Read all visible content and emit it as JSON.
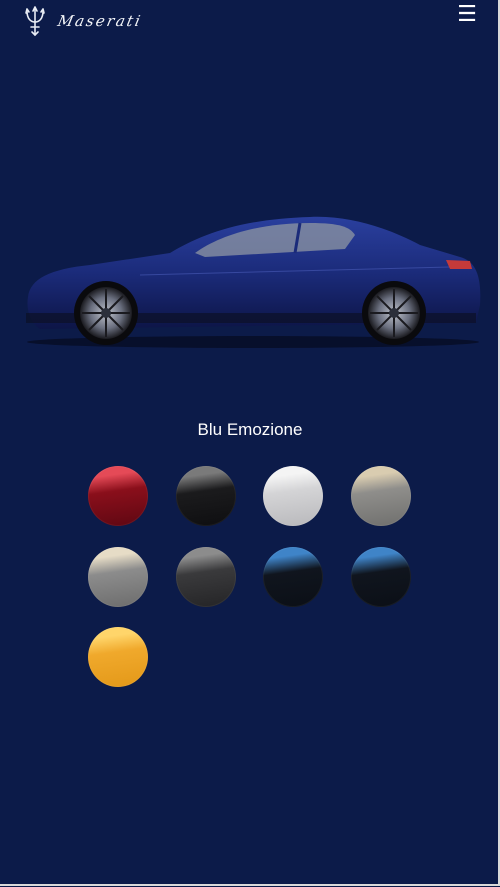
{
  "header": {
    "brand": "Maserati",
    "menu_icon": "hamburger-menu-icon",
    "logo_icon": "trident-icon"
  },
  "selected_color": "Blu Emozione",
  "colors": {
    "background": "#0c1b49",
    "car_body": "#1b2b7a"
  },
  "swatches": [
    {
      "top": "#e54a57",
      "mid": "#8a0f1b",
      "bottom": "#5e0712"
    },
    {
      "top": "#7a7a7a",
      "mid": "#1b1b1d",
      "bottom": "#0e0e10"
    },
    {
      "top": "#f4f4f4",
      "mid": "#d4d4d6",
      "bottom": "#b8b8bb"
    },
    {
      "top": "#d9ccb0",
      "mid": "#8f8e8b",
      "bottom": "#6f6f6d"
    },
    {
      "top": "#e6dcc6",
      "mid": "#8c8c8c",
      "bottom": "#6c6c6c"
    },
    {
      "top": "#8c8c8c",
      "mid": "#3a3a3c",
      "bottom": "#242426"
    },
    {
      "top": "#3f84c8",
      "mid": "#10151e",
      "bottom": "#0b0f16"
    },
    {
      "top": "#3f84c8",
      "mid": "#10151e",
      "bottom": "#0b0f16"
    },
    {
      "top": "#ffd56a",
      "mid": "#f0a92c",
      "bottom": "#e39818"
    }
  ]
}
